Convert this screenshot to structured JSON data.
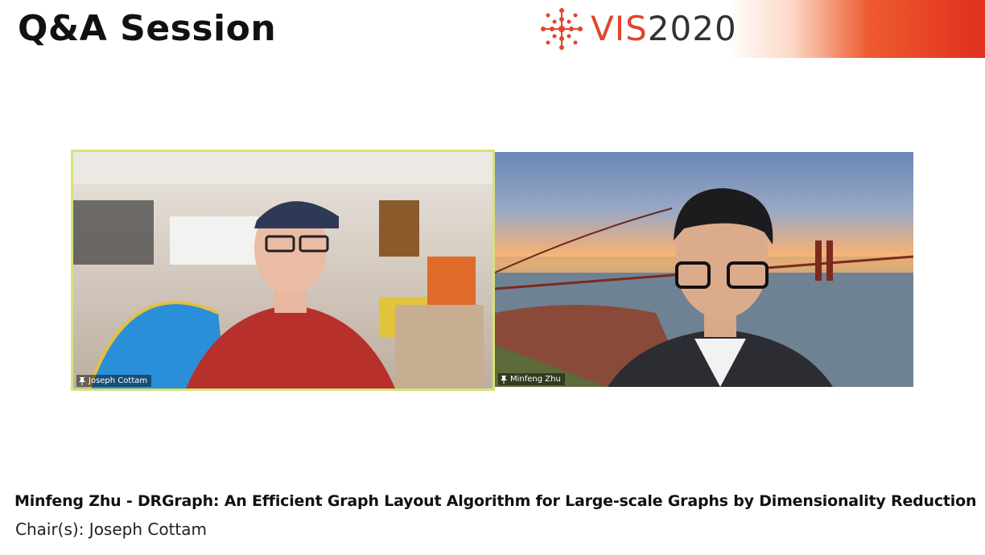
{
  "header": {
    "title": "Q&A Session",
    "brand_name": "VIS",
    "brand_year": "2020",
    "brand_color": "#e2452b"
  },
  "participants": [
    {
      "name": "Joseph Cottam",
      "active_speaker": true,
      "pin_icon": "pin-icon"
    },
    {
      "name": "Minfeng Zhu",
      "active_speaker": false,
      "pin_icon": "pin-icon"
    }
  ],
  "caption": {
    "title": "Minfeng Zhu - DRGraph: An Efficient Graph Layout Algorithm for Large-scale Graphs by Dimensionality Reduction",
    "chair": "Chair(s): Joseph Cottam"
  },
  "colors": {
    "active_border": "#d6e37a",
    "banner_accent": "#e0301f"
  }
}
